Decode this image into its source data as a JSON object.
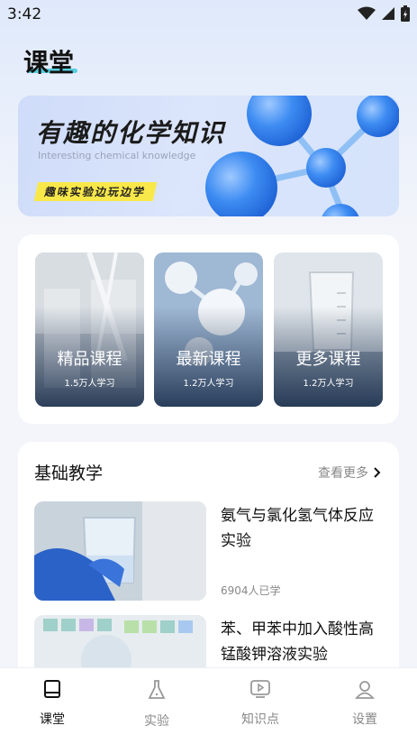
{
  "status": {
    "time": "3:42"
  },
  "page": {
    "title": "课堂",
    "accent": "#3dc8d8"
  },
  "banner": {
    "headline": "有趣的化学知识",
    "subtitle": "Interesting chemical knowledge",
    "tag": "趣味实验边玩边学"
  },
  "courses": [
    {
      "name": "精品课程",
      "count": "1.5万人学习"
    },
    {
      "name": "最新课程",
      "count": "1.2万人学习"
    },
    {
      "name": "更多课程",
      "count": "1.2万人学习"
    }
  ],
  "basic": {
    "heading": "基础教学",
    "more": "查看更多",
    "items": [
      {
        "title": "氨气与氯化氢气体反应实验",
        "learned": "6904人已学"
      },
      {
        "title": "苯、甲苯中加入酸性高锰酸钾溶液实验",
        "learned": ""
      }
    ]
  },
  "nav": [
    {
      "label": "课堂",
      "icon": "book-icon",
      "active": true
    },
    {
      "label": "实验",
      "icon": "flask-icon",
      "active": false
    },
    {
      "label": "知识点",
      "icon": "video-icon",
      "active": false
    },
    {
      "label": "设置",
      "icon": "user-icon",
      "active": false
    }
  ]
}
